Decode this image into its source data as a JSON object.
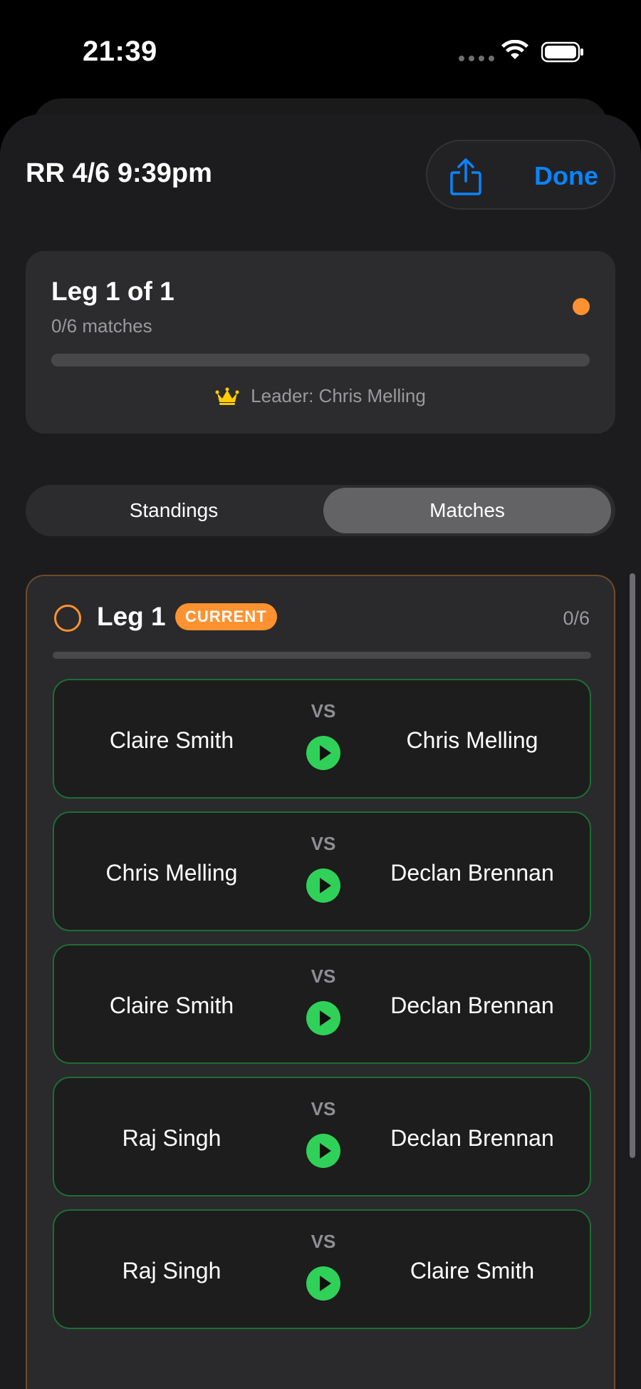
{
  "status_bar": {
    "time": "21:39"
  },
  "header": {
    "title": "RR 4/6 9:39pm",
    "done_label": "Done"
  },
  "summary": {
    "leg_title": "Leg 1 of 1",
    "matches_text": "0/6 matches",
    "progress": 0,
    "leader_text": "Leader: Chris Melling"
  },
  "segments": {
    "standings": "Standings",
    "matches": "Matches",
    "selected": "Matches"
  },
  "leg_panel": {
    "title": "Leg 1",
    "badge": "CURRENT",
    "count": "0/6",
    "progress": 0,
    "matches": [
      {
        "left": "Claire Smith",
        "vs": "VS",
        "right": "Chris Melling"
      },
      {
        "left": "Chris Melling",
        "vs": "VS",
        "right": "Declan Brennan"
      },
      {
        "left": "Claire Smith",
        "vs": "VS",
        "right": "Declan Brennan"
      },
      {
        "left": "Raj Singh",
        "vs": "VS",
        "right": "Declan Brennan"
      },
      {
        "left": "Raj Singh",
        "vs": "VS",
        "right": "Claire Smith"
      }
    ]
  },
  "colors": {
    "accent": "#0a84ff",
    "current": "#ff9230",
    "play": "#30d158",
    "match_border": "#1f6b35"
  },
  "icons": {
    "share": "share-icon",
    "crown": "crown-icon",
    "play": "play-icon"
  }
}
